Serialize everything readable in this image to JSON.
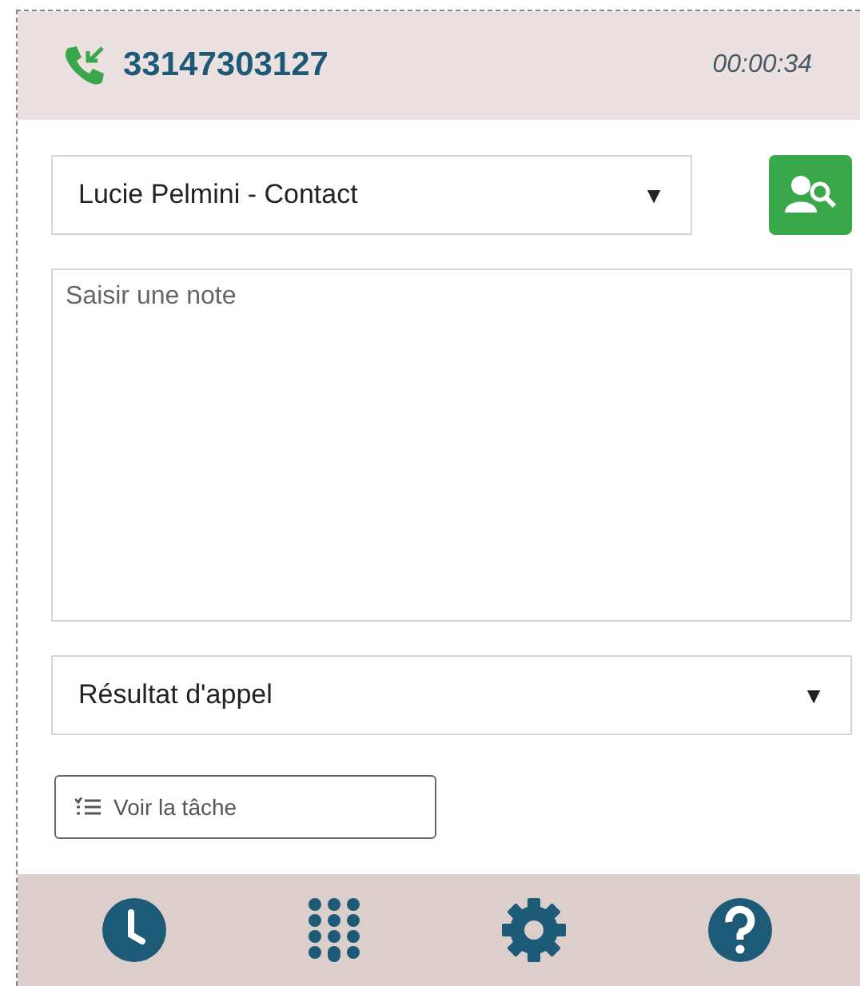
{
  "header": {
    "phone_number": "33147303127",
    "duration": "00:00:34"
  },
  "contact_select": {
    "value": "Lucie Pelmini - Contact",
    "arrow": "▼"
  },
  "note": {
    "placeholder": "Saisir une note"
  },
  "result_select": {
    "value": "Résultat d'appel",
    "arrow": "▼"
  },
  "task_button": {
    "label": "Voir la tâche"
  },
  "footer": {
    "buttons": [
      {
        "kind": "history"
      },
      {
        "kind": "dialpad"
      },
      {
        "kind": "settings"
      },
      {
        "kind": "help"
      }
    ]
  }
}
